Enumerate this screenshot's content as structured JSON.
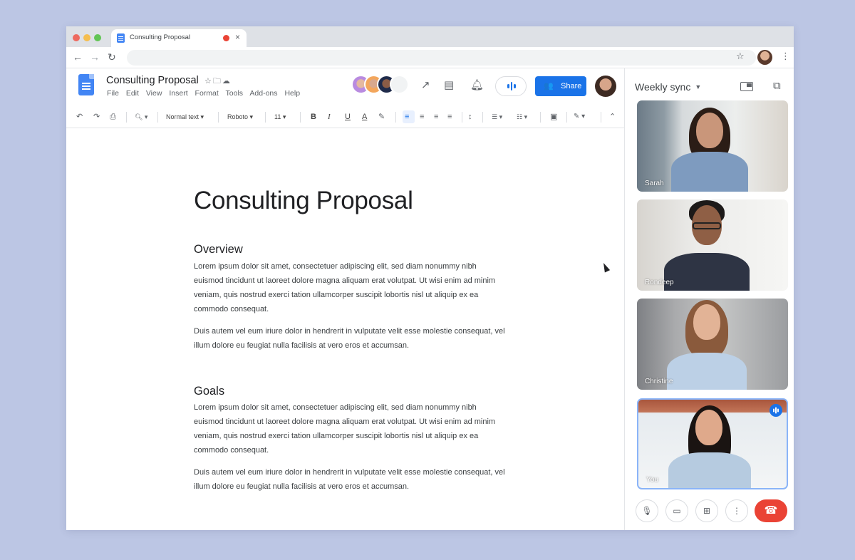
{
  "browser": {
    "tab_title": "Consulting Proposal",
    "back_icon": "←",
    "forward_icon": "→",
    "reload_icon": "↻",
    "star_icon": "☆",
    "menu_icon": "⋮",
    "close_icon": "×"
  },
  "docs": {
    "title": "Consulting Proposal",
    "title_icons": "☆🗀☁",
    "menu": [
      "File",
      "Edit",
      "View",
      "Insert",
      "Format",
      "Tools",
      "Add-ons",
      "Help"
    ],
    "share_label": "Share",
    "share_icon": "👥"
  },
  "toolbar": {
    "undo": "↶",
    "redo": "↷",
    "print": "⎙",
    "zoom": "🔍︎ ▾",
    "style": "Normal text ▾",
    "font": "Roboto ▾",
    "size": "11 ▾",
    "bold": "B",
    "italic": "I",
    "underline": "U",
    "text_color": "A",
    "highlight": "✎",
    "align_left": "≡",
    "align_center": "≡",
    "align_right": "≡",
    "justify": "≡",
    "line_spacing": "↕",
    "bullets": "☰ ▾",
    "numbered": "☷ ▾",
    "image": "▣",
    "edit_mode": "✎ ▾",
    "collapse": "⌃"
  },
  "document": {
    "heading": "Consulting Proposal",
    "sections": [
      {
        "title": "Overview",
        "paragraphs": [
          "Lorem ipsum dolor sit amet, consectetuer adipiscing elit, sed diam nonummy nibh euismod tincidunt ut laoreet dolore magna aliquam erat volutpat. Ut wisi enim ad minim veniam, quis nostrud exerci tation ullamcorper suscipit lobortis nisl ut aliquip ex ea commodo consequat.",
          "Duis autem vel eum iriure dolor in hendrerit in vulputate velit esse molestie consequat, vel illum dolore eu feugiat nulla facilisis at vero eros et accumsan."
        ]
      },
      {
        "title": "Goals",
        "paragraphs": [
          "Lorem ipsum dolor sit amet, consectetuer adipiscing elit, sed diam nonummy nibh euismod tincidunt ut laoreet dolore magna aliquam erat volutpat. Ut wisi enim ad minim veniam, quis nostrud exerci tation ullamcorper suscipit lobortis nisl ut aliquip ex ea commodo consequat.",
          "Duis autem vel eum iriure dolor in hendrerit in vulputate velit esse molestie consequat, vel illum dolore eu feugiat nulla facilisis at vero eros et accumsan."
        ]
      }
    ]
  },
  "meet": {
    "title": "Weekly sync",
    "caret": "▼",
    "popout_icon": "⧉",
    "participants": [
      {
        "name": "Sarah"
      },
      {
        "name": "Rondeep"
      },
      {
        "name": "Christine"
      },
      {
        "name": "You"
      }
    ],
    "controls": {
      "mic": "🎙︎",
      "camera": "▭",
      "present": "⊞",
      "more": "⋮",
      "end": "☎"
    }
  },
  "colors": {
    "accent": "#1a73e8",
    "end_call": "#ea4335",
    "background": "#bcc6e4"
  }
}
